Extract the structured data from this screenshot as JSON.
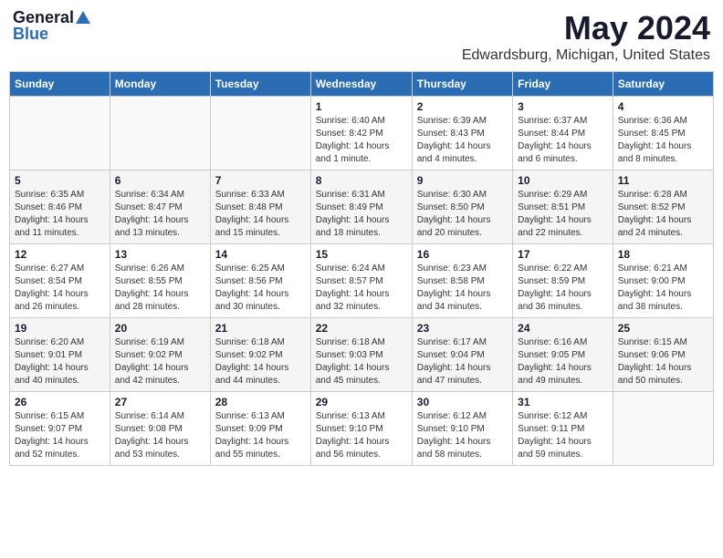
{
  "logo": {
    "general": "General",
    "blue": "Blue"
  },
  "title": "May 2024",
  "subtitle": "Edwardsburg, Michigan, United States",
  "days_of_week": [
    "Sunday",
    "Monday",
    "Tuesday",
    "Wednesday",
    "Thursday",
    "Friday",
    "Saturday"
  ],
  "weeks": [
    [
      {
        "day": "",
        "info": ""
      },
      {
        "day": "",
        "info": ""
      },
      {
        "day": "",
        "info": ""
      },
      {
        "day": "1",
        "info": "Sunrise: 6:40 AM\nSunset: 8:42 PM\nDaylight: 14 hours\nand 1 minute."
      },
      {
        "day": "2",
        "info": "Sunrise: 6:39 AM\nSunset: 8:43 PM\nDaylight: 14 hours\nand 4 minutes."
      },
      {
        "day": "3",
        "info": "Sunrise: 6:37 AM\nSunset: 8:44 PM\nDaylight: 14 hours\nand 6 minutes."
      },
      {
        "day": "4",
        "info": "Sunrise: 6:36 AM\nSunset: 8:45 PM\nDaylight: 14 hours\nand 8 minutes."
      }
    ],
    [
      {
        "day": "5",
        "info": "Sunrise: 6:35 AM\nSunset: 8:46 PM\nDaylight: 14 hours\nand 11 minutes."
      },
      {
        "day": "6",
        "info": "Sunrise: 6:34 AM\nSunset: 8:47 PM\nDaylight: 14 hours\nand 13 minutes."
      },
      {
        "day": "7",
        "info": "Sunrise: 6:33 AM\nSunset: 8:48 PM\nDaylight: 14 hours\nand 15 minutes."
      },
      {
        "day": "8",
        "info": "Sunrise: 6:31 AM\nSunset: 8:49 PM\nDaylight: 14 hours\nand 18 minutes."
      },
      {
        "day": "9",
        "info": "Sunrise: 6:30 AM\nSunset: 8:50 PM\nDaylight: 14 hours\nand 20 minutes."
      },
      {
        "day": "10",
        "info": "Sunrise: 6:29 AM\nSunset: 8:51 PM\nDaylight: 14 hours\nand 22 minutes."
      },
      {
        "day": "11",
        "info": "Sunrise: 6:28 AM\nSunset: 8:52 PM\nDaylight: 14 hours\nand 24 minutes."
      }
    ],
    [
      {
        "day": "12",
        "info": "Sunrise: 6:27 AM\nSunset: 8:54 PM\nDaylight: 14 hours\nand 26 minutes."
      },
      {
        "day": "13",
        "info": "Sunrise: 6:26 AM\nSunset: 8:55 PM\nDaylight: 14 hours\nand 28 minutes."
      },
      {
        "day": "14",
        "info": "Sunrise: 6:25 AM\nSunset: 8:56 PM\nDaylight: 14 hours\nand 30 minutes."
      },
      {
        "day": "15",
        "info": "Sunrise: 6:24 AM\nSunset: 8:57 PM\nDaylight: 14 hours\nand 32 minutes."
      },
      {
        "day": "16",
        "info": "Sunrise: 6:23 AM\nSunset: 8:58 PM\nDaylight: 14 hours\nand 34 minutes."
      },
      {
        "day": "17",
        "info": "Sunrise: 6:22 AM\nSunset: 8:59 PM\nDaylight: 14 hours\nand 36 minutes."
      },
      {
        "day": "18",
        "info": "Sunrise: 6:21 AM\nSunset: 9:00 PM\nDaylight: 14 hours\nand 38 minutes."
      }
    ],
    [
      {
        "day": "19",
        "info": "Sunrise: 6:20 AM\nSunset: 9:01 PM\nDaylight: 14 hours\nand 40 minutes."
      },
      {
        "day": "20",
        "info": "Sunrise: 6:19 AM\nSunset: 9:02 PM\nDaylight: 14 hours\nand 42 minutes."
      },
      {
        "day": "21",
        "info": "Sunrise: 6:18 AM\nSunset: 9:02 PM\nDaylight: 14 hours\nand 44 minutes."
      },
      {
        "day": "22",
        "info": "Sunrise: 6:18 AM\nSunset: 9:03 PM\nDaylight: 14 hours\nand 45 minutes."
      },
      {
        "day": "23",
        "info": "Sunrise: 6:17 AM\nSunset: 9:04 PM\nDaylight: 14 hours\nand 47 minutes."
      },
      {
        "day": "24",
        "info": "Sunrise: 6:16 AM\nSunset: 9:05 PM\nDaylight: 14 hours\nand 49 minutes."
      },
      {
        "day": "25",
        "info": "Sunrise: 6:15 AM\nSunset: 9:06 PM\nDaylight: 14 hours\nand 50 minutes."
      }
    ],
    [
      {
        "day": "26",
        "info": "Sunrise: 6:15 AM\nSunset: 9:07 PM\nDaylight: 14 hours\nand 52 minutes."
      },
      {
        "day": "27",
        "info": "Sunrise: 6:14 AM\nSunset: 9:08 PM\nDaylight: 14 hours\nand 53 minutes."
      },
      {
        "day": "28",
        "info": "Sunrise: 6:13 AM\nSunset: 9:09 PM\nDaylight: 14 hours\nand 55 minutes."
      },
      {
        "day": "29",
        "info": "Sunrise: 6:13 AM\nSunset: 9:10 PM\nDaylight: 14 hours\nand 56 minutes."
      },
      {
        "day": "30",
        "info": "Sunrise: 6:12 AM\nSunset: 9:10 PM\nDaylight: 14 hours\nand 58 minutes."
      },
      {
        "day": "31",
        "info": "Sunrise: 6:12 AM\nSunset: 9:11 PM\nDaylight: 14 hours\nand 59 minutes."
      },
      {
        "day": "",
        "info": ""
      }
    ]
  ]
}
